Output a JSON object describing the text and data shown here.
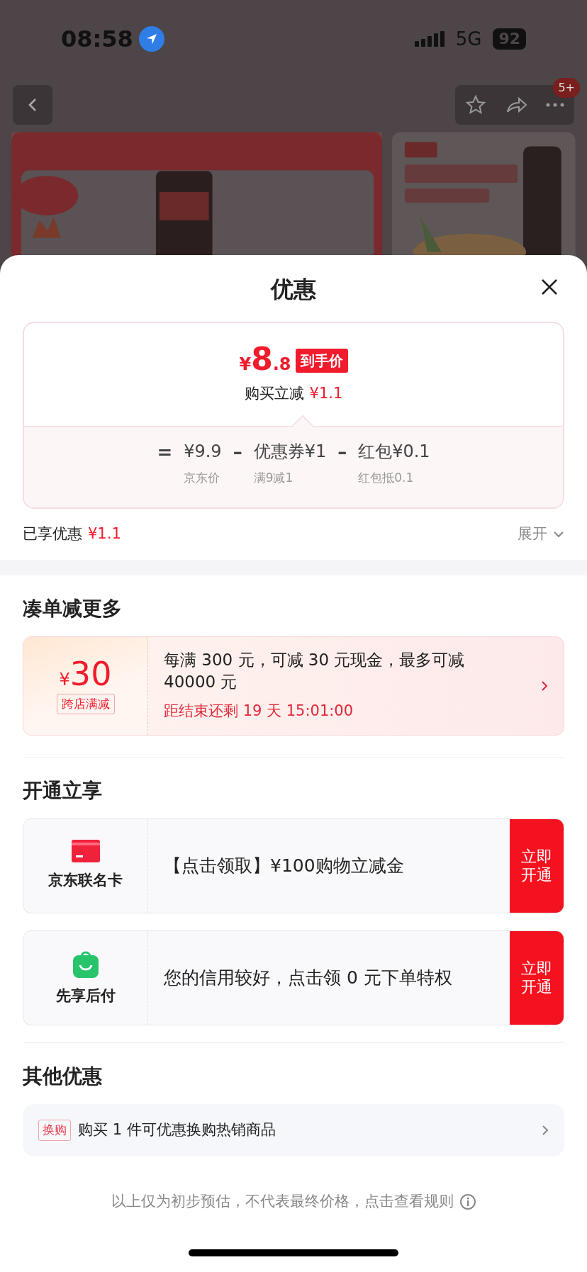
{
  "status_bar": {
    "time": "08:58",
    "network": "5G",
    "battery": "92"
  },
  "nav": {
    "badge": "5+"
  },
  "sheet": {
    "title": "优惠",
    "price_card": {
      "currency": "¥",
      "price_int": "8",
      "price_dec": ".8",
      "tag": "到手价",
      "reduce_label": "购买立减",
      "reduce_amount": "¥1.1",
      "formula": [
        {
          "kind": "op",
          "text": "="
        },
        {
          "kind": "term",
          "text": "¥9.9",
          "sub": "京东价"
        },
        {
          "kind": "op",
          "text": "–"
        },
        {
          "kind": "term",
          "text": "优惠券¥1",
          "sub": "满9减1"
        },
        {
          "kind": "op",
          "text": "–"
        },
        {
          "kind": "term",
          "text": "红包¥0.1",
          "sub": "红包抵0.1"
        }
      ]
    },
    "enjoyed": {
      "label": "已享优惠",
      "amount": "¥1.1"
    },
    "expand": {
      "label": "展开",
      "expanded": false
    },
    "bundle": {
      "title": "凑单减更多",
      "coupon": {
        "currency": "¥",
        "amount": "30",
        "tag": "跨店满减",
        "description": "每满 300 元，可减 30 元现金，最多可减 40000 元",
        "countdown": "距结束还剩 19 天 15:01:00"
      }
    },
    "open": {
      "title": "开通立享",
      "offers": [
        {
          "kind": "card",
          "name": "京东联名卡",
          "text": "【点击领取】¥100购物立减金",
          "button": "立即开通"
        },
        {
          "kind": "bag",
          "name": "先享后付",
          "text": "您的信用较好，点击领 0 元下单特权",
          "button": "立即开通"
        }
      ]
    },
    "other": {
      "title": "其他优惠",
      "items": [
        {
          "tag": "换购",
          "text": "购买 1 件可优惠换购热销商品"
        }
      ]
    },
    "footer": "以上仅为初步预估，不代表最终价格，点击查看规则"
  }
}
